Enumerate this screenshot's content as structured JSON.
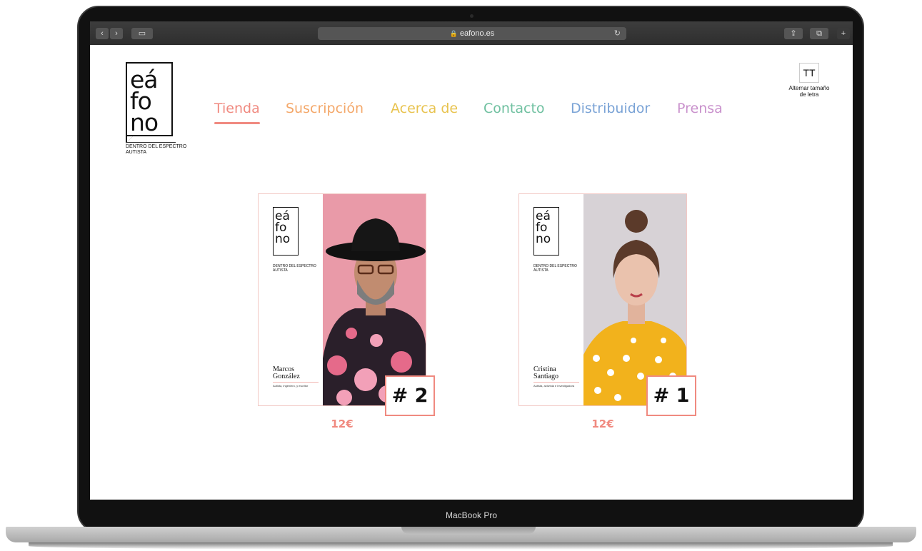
{
  "browser": {
    "url": "eafono.es",
    "buttons": {
      "back": "‹",
      "forward": "›",
      "sidebar": "▭",
      "share": "⇪",
      "tabs": "⧉",
      "new_tab": "+",
      "reload": "↻"
    }
  },
  "logo": {
    "lines": [
      "eá",
      "fo",
      "no"
    ],
    "tagline": "DENTRO DEL ESPECTRO AUTISTA"
  },
  "nav": {
    "items": [
      {
        "label": "Tienda",
        "color": "#f08a80",
        "active": true
      },
      {
        "label": "Suscripción",
        "color": "#f4a86a",
        "active": false
      },
      {
        "label": "Acerca de",
        "color": "#e8c34f",
        "active": false
      },
      {
        "label": "Contacto",
        "color": "#6fc0a0",
        "active": false
      },
      {
        "label": "Distribuidor",
        "color": "#7aa3d6",
        "active": false
      },
      {
        "label": "Prensa",
        "color": "#c991cc",
        "active": false
      }
    ]
  },
  "text_size_toggle": {
    "icon_label": "TT",
    "label": "Alternar tamaño de letra"
  },
  "products": [
    {
      "name": "Marcos González",
      "description": "Autista, ingeniero, y escritor",
      "rank": "# 2",
      "price": "12€",
      "photo_bg": "#e99aa8"
    },
    {
      "name": "Cristina Santiago",
      "description": "Autista, activista e investigadora",
      "rank": "# 1",
      "price": "12€",
      "photo_bg": "#d7d2d6"
    }
  ],
  "device_label": "MacBook Pro"
}
